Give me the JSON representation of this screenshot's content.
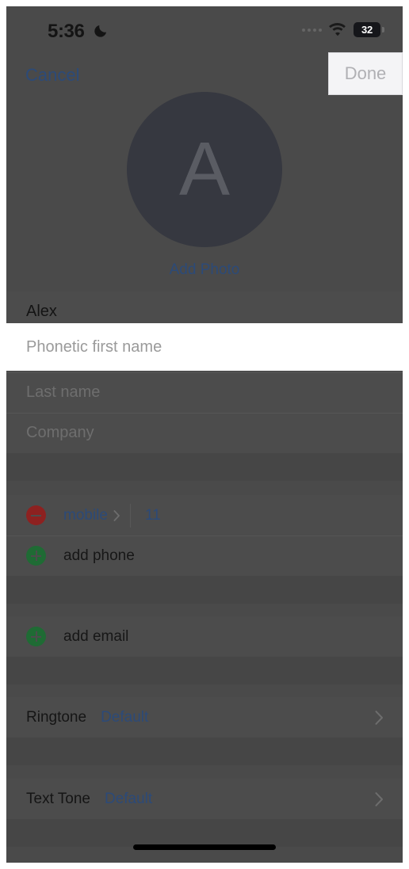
{
  "status_bar": {
    "time": "5:36",
    "dnd_icon": "moon-icon",
    "signal_icon": "signal-dots-icon",
    "wifi_icon": "wifi-icon",
    "battery_level": "32"
  },
  "nav_bar": {
    "cancel_label": "Cancel",
    "done_label": "Done"
  },
  "avatar": {
    "initial": "A",
    "add_photo_label": "Add Photo"
  },
  "name_fields": {
    "first_name_value": "Alex",
    "phonetic_first_name_placeholder": "Phonetic first name",
    "last_name_placeholder": "Last name",
    "company_placeholder": "Company"
  },
  "phone_section": {
    "entry": {
      "delete_icon": "minus-circle-icon",
      "type_label": "mobile",
      "type_chevron_icon": "chevron-right-icon",
      "number": "11"
    },
    "add_icon": "plus-circle-icon",
    "add_label": "add phone"
  },
  "email_section": {
    "add_icon": "plus-circle-icon",
    "add_label": "add email"
  },
  "tone_rows": [
    {
      "label": "Ringtone",
      "value": "Default",
      "chevron_icon": "chevron-right-icon"
    },
    {
      "label": "Text Tone",
      "value": "Default",
      "chevron_icon": "chevron-right-icon"
    }
  ],
  "spotlights": {
    "phonetic_text": "Phonetic first name",
    "done_text": "Done"
  },
  "colors": {
    "accent_blue": "#2c4a78",
    "delete_red": "#8d2120",
    "add_green": "#1f6b34",
    "dim_background": "#4c4c4c",
    "highlight_white": "#ffffff"
  }
}
